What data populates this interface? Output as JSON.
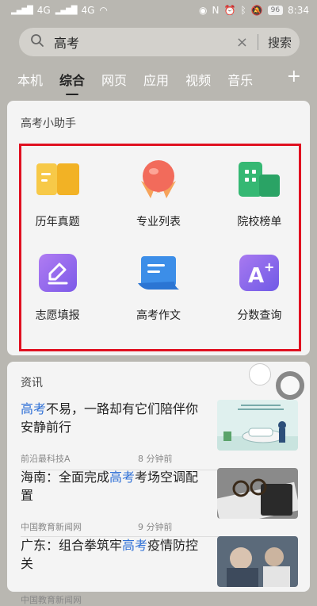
{
  "status": {
    "carrier1": "4G",
    "carrier2": "4G",
    "battery": "96",
    "time": "8:34"
  },
  "search": {
    "query": "高考",
    "button": "搜索"
  },
  "tabs": [
    {
      "label": "本机"
    },
    {
      "label": "综合"
    },
    {
      "label": "网页"
    },
    {
      "label": "应用"
    },
    {
      "label": "视频"
    },
    {
      "label": "音乐"
    }
  ],
  "helper": {
    "title": "高考小助手",
    "items": [
      {
        "label": "历年真题",
        "icon": "book-icon"
      },
      {
        "label": "专业列表",
        "icon": "medal-icon"
      },
      {
        "label": "院校榜单",
        "icon": "building-icon"
      },
      {
        "label": "志愿填报",
        "icon": "edit-icon"
      },
      {
        "label": "高考作文",
        "icon": "document-icon"
      },
      {
        "label": "分数查询",
        "icon": "score-icon"
      }
    ]
  },
  "news": {
    "title": "资讯",
    "items": [
      {
        "kw_prefix": "高考",
        "text": "不易，一路却有它们陪伴你安静前行",
        "source": "前沿最科技A",
        "time": "8 分钟前"
      },
      {
        "pre": "海南：全面完成",
        "kw": "高考",
        "post": "考场空调配置",
        "source": "中国教育新闻网",
        "time": "9 分钟前"
      },
      {
        "pre": "广东：组合拳筑牢",
        "kw": "高考",
        "post": "疫情防控关",
        "source": "中国教育新闻网",
        "time": ""
      }
    ]
  },
  "colors": {
    "accent": "#2e6fd6",
    "highlight": "#e01020"
  }
}
